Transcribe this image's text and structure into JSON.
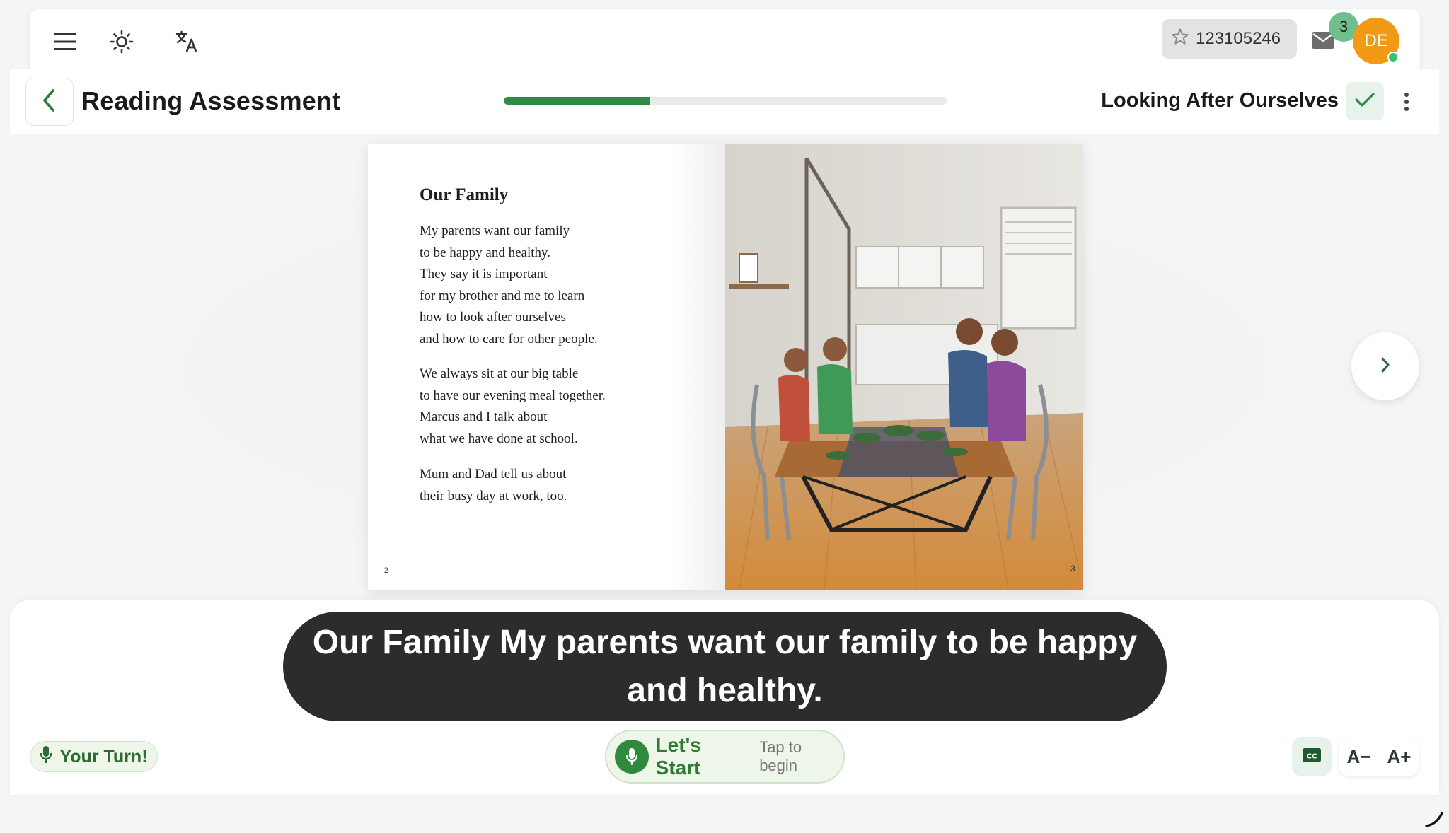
{
  "topbar": {
    "user_id": "123105246",
    "notification_count": "3",
    "avatar_initials": "DE"
  },
  "header": {
    "title": "Reading Assessment",
    "progress_fraction": 0.33,
    "book_title": "Looking After Ourselves"
  },
  "book": {
    "left_page": {
      "heading": "Our Family",
      "stanzas": [
        [
          "My parents want our family",
          "to be happy and healthy.",
          "They say it is important",
          "for my brother and me to learn",
          "how to look after ourselves",
          "and how to care for other people."
        ],
        [
          "We always sit at our big table",
          "to have our evening meal together.",
          "Marcus and I talk about",
          "what we have done at school."
        ],
        [
          "Mum and Dad tell us about",
          "their busy day at work, too."
        ]
      ],
      "page_number": "2"
    },
    "right_page": {
      "page_number": "3"
    }
  },
  "caption": "Our Family My parents want our family to be happy and healthy.",
  "controls": {
    "your_turn_label": "Your Turn!",
    "start_label": "Let's Start",
    "start_hint": "Tap to begin",
    "font_decrease": "A−",
    "font_increase": "A+",
    "cc_label": "CC"
  },
  "colors": {
    "accent_green": "#2f8a47",
    "avatar_orange": "#f29a16",
    "badge_green": "#6fbf8c",
    "caption_bg": "#2b2d2b"
  }
}
